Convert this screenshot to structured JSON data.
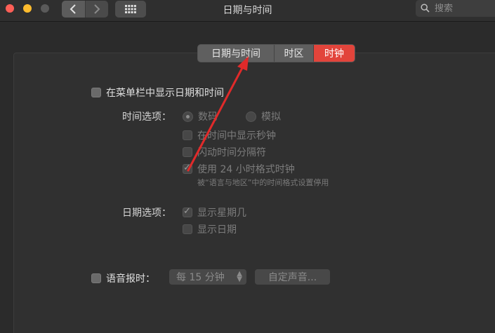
{
  "window": {
    "title": "日期与时间",
    "search_placeholder": "搜索"
  },
  "tabs": [
    {
      "label": "日期与时间",
      "selected": false
    },
    {
      "label": "时区",
      "selected": false
    },
    {
      "label": "时钟",
      "selected": true
    }
  ],
  "clock": {
    "show_in_menubar": {
      "label": "在菜单栏中显示日期和时间",
      "checked": false
    },
    "time_options_label": "时间选项：",
    "radio_digital": {
      "label": "数码",
      "selected": true
    },
    "radio_analog": {
      "label": "模拟",
      "selected": false
    },
    "show_seconds": {
      "label": "在时间中显示秒钟",
      "checked": false
    },
    "flash_separators": {
      "label": "闪动时间分隔符",
      "checked": false
    },
    "use_24h": {
      "label": "使用 24 小时格式时钟",
      "checked": true
    },
    "use_24h_note": "被“语言与地区”中的时间格式设置停用",
    "date_options_label": "日期选项：",
    "show_weekday": {
      "label": "显示星期几",
      "checked": true
    },
    "show_date": {
      "label": "显示日期",
      "checked": false
    },
    "announce_time": {
      "label": "语音报时：",
      "checked": false
    },
    "interval_select": "每 15 分钟",
    "custom_voice_button": "自定声音..."
  },
  "colors": {
    "accent_tab": "#e2443b",
    "annotation_arrow": "#e02a2a"
  }
}
